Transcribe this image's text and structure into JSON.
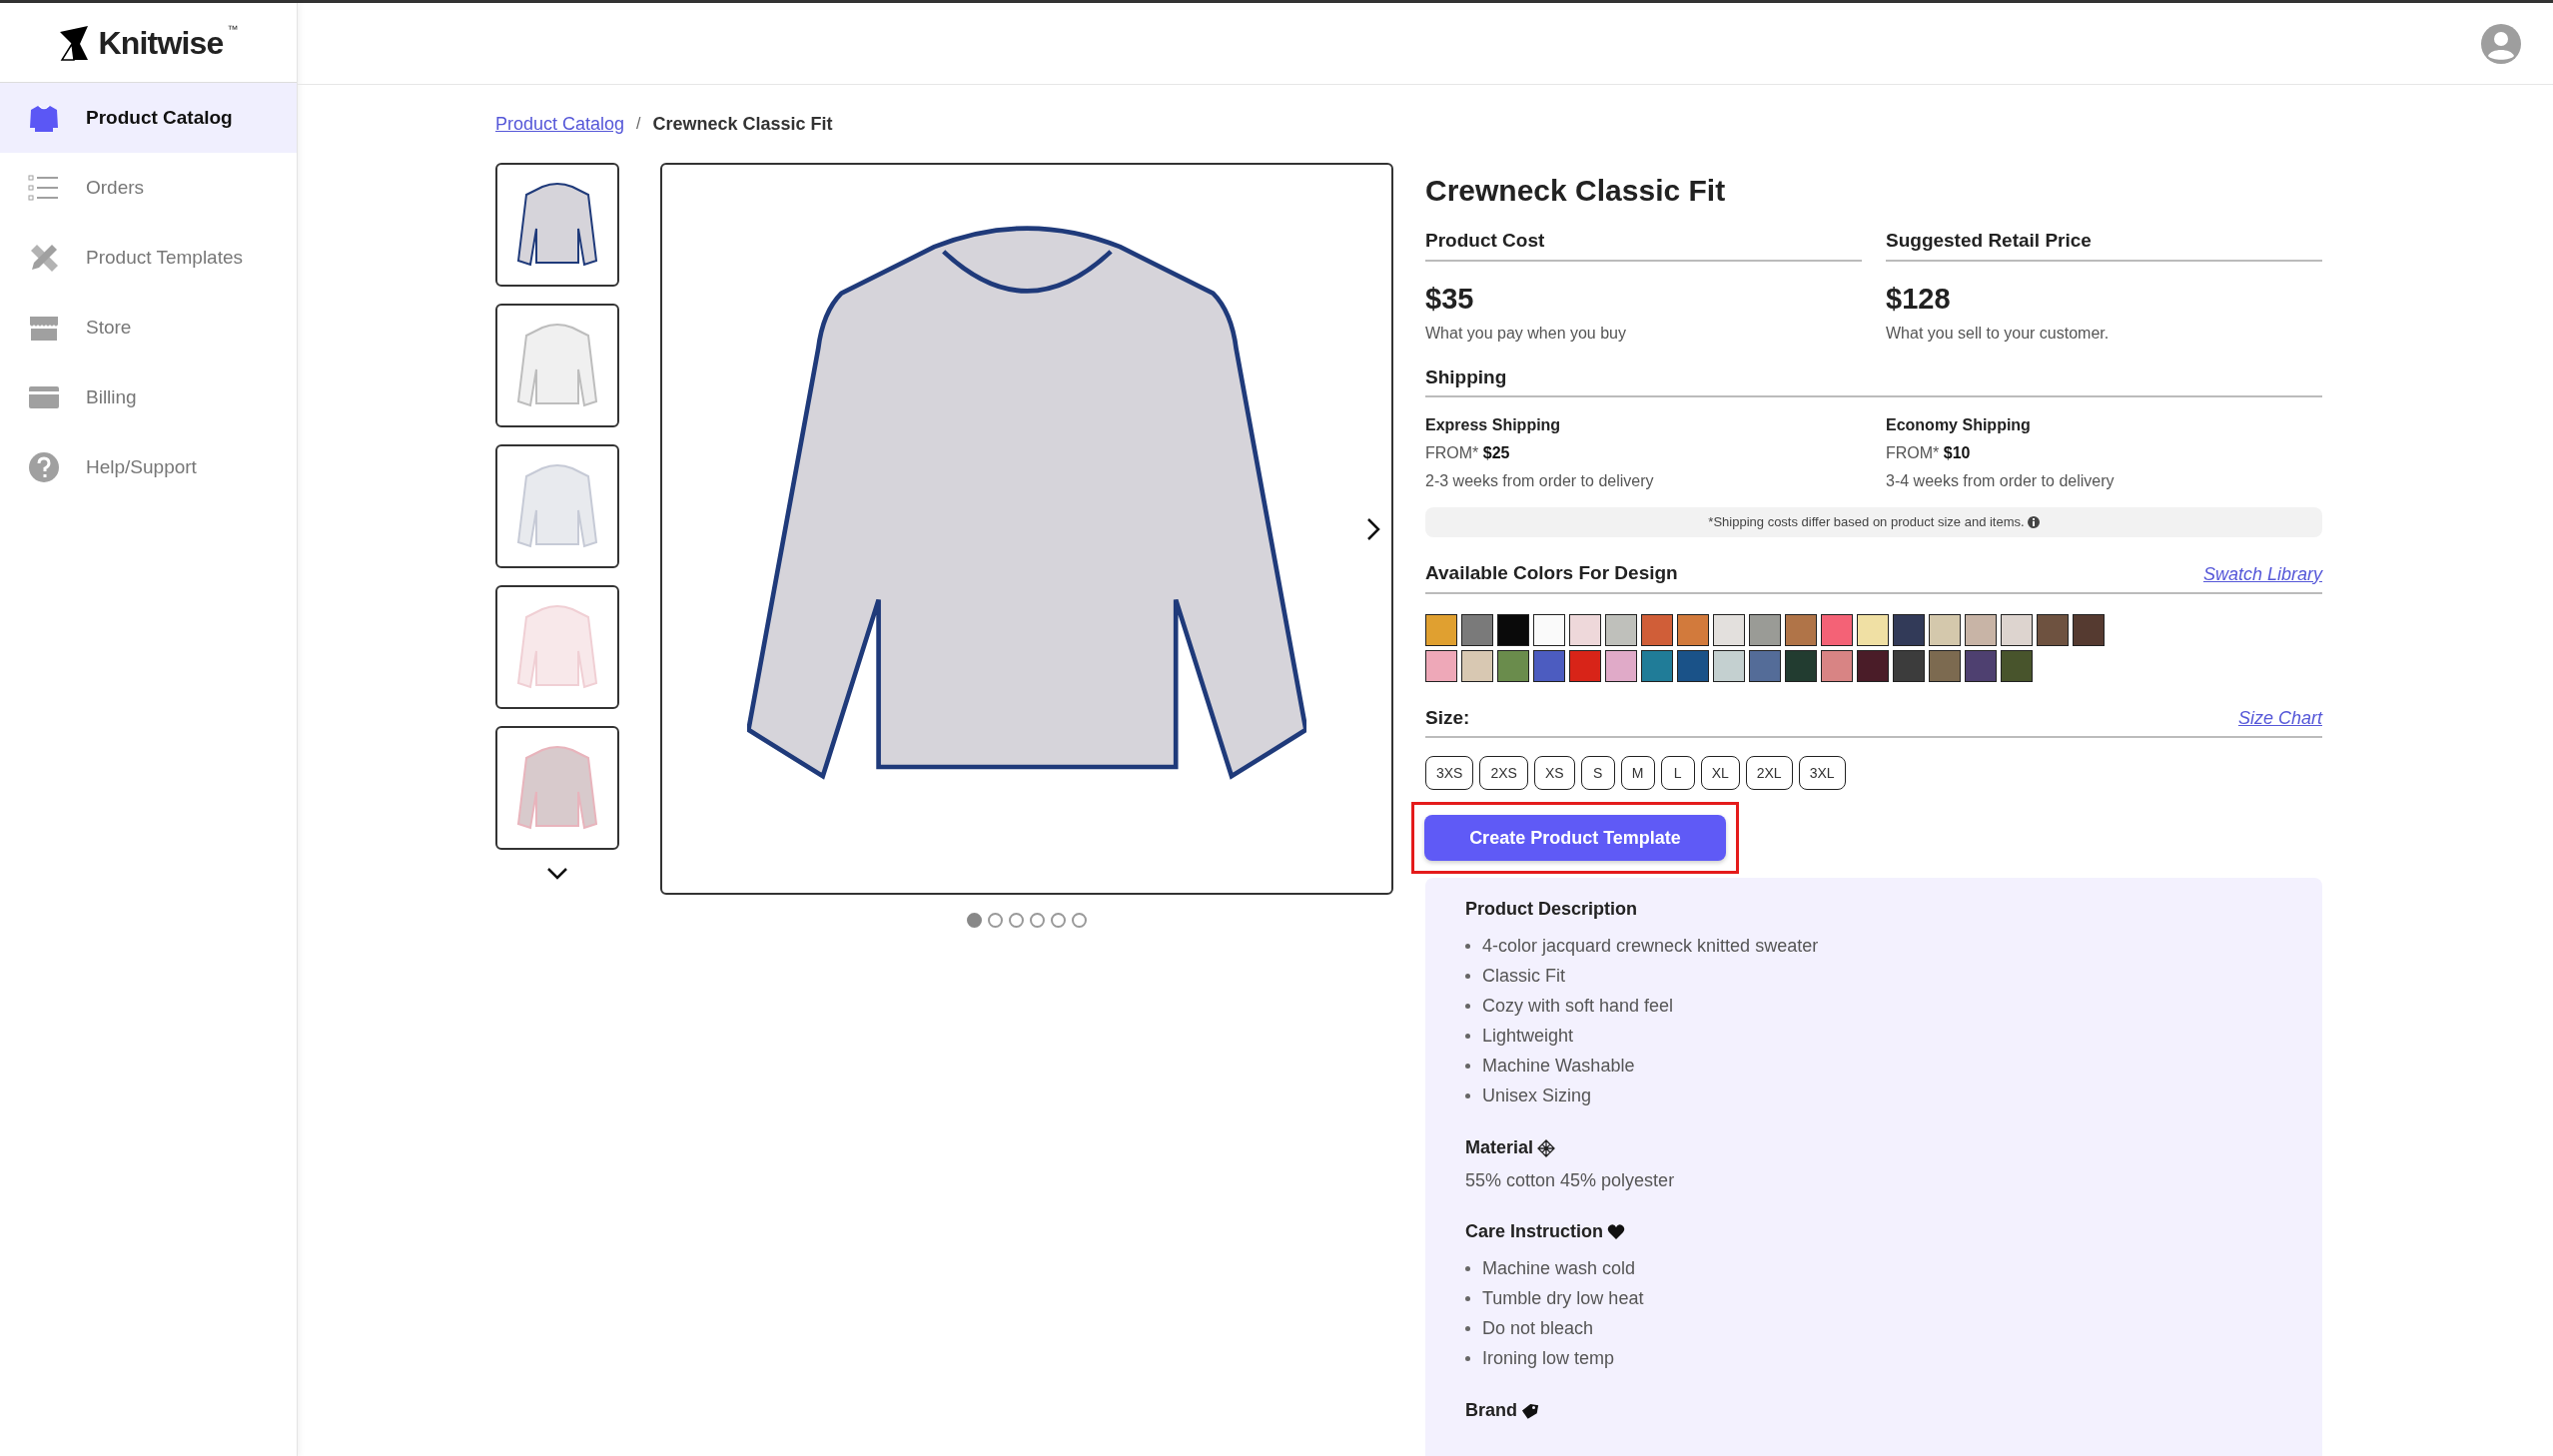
{
  "brand": {
    "name": "Knitwise",
    "trademark": "™"
  },
  "sidebar": {
    "items": [
      {
        "label": "Product Catalog",
        "kind": "sweater",
        "selected": true
      },
      {
        "label": "Orders",
        "kind": "list",
        "selected": false
      },
      {
        "label": "Product Templates",
        "kind": "tools",
        "selected": false
      },
      {
        "label": "Store",
        "kind": "store",
        "selected": false
      },
      {
        "label": "Billing",
        "kind": "card",
        "selected": false
      },
      {
        "label": "Help/Support",
        "kind": "help",
        "selected": false
      }
    ]
  },
  "breadcrumb_separator": "/",
  "breadcrumb": [
    {
      "label": "Product Catalog",
      "kind": "link"
    },
    {
      "label": "Crewneck Classic Fit",
      "kind": "current"
    }
  ],
  "gallery": {
    "dots": [
      {
        "selected": true
      },
      {
        "selected": false
      },
      {
        "selected": false
      },
      {
        "selected": false
      },
      {
        "selected": false
      },
      {
        "selected": false
      }
    ]
  },
  "product": {
    "title": "Crewneck Classic Fit",
    "pricing": [
      {
        "heading": "Product Cost",
        "price": "$35",
        "note": "What you pay when you buy"
      },
      {
        "heading": "Suggested Retail Price",
        "price": "$128",
        "note": "What you sell to your customer."
      }
    ],
    "shipping": {
      "heading": "Shipping",
      "options": [
        {
          "name": "Express Shipping",
          "from_label": "FROM*",
          "price": "$25",
          "time": "2-3 weeks from order to delivery"
        },
        {
          "name": "Economy Shipping",
          "from_label": "FROM*",
          "price": "$10",
          "time": "3-4 weeks from order to delivery"
        }
      ],
      "note": "*Shipping costs differ based on product size and items."
    },
    "colors": {
      "heading": "Available Colors For Design",
      "link": "Swatch Library",
      "swatches": [
        {
          "color": "#e0a030"
        },
        {
          "color": "#7a7a7a"
        },
        {
          "color": "#0a0a0a"
        },
        {
          "color": "#fafafa"
        },
        {
          "color": "#eed8da"
        },
        {
          "color": "#bfc0bb"
        },
        {
          "color": "#d05e38"
        },
        {
          "color": "#d27a3c"
        },
        {
          "color": "#e3e0dd"
        },
        {
          "color": "#9a9b96"
        },
        {
          "color": "#b07448"
        },
        {
          "color": "#f46276"
        },
        {
          "color": "#f0e0a4"
        },
        {
          "color": "#323a58"
        },
        {
          "color": "#d4c8ac"
        },
        {
          "color": "#c8b4a6"
        },
        {
          "color": "#ddd4cf"
        },
        {
          "color": "#6e5240"
        },
        {
          "color": "#553a30"
        },
        {
          "color": "#eea8b8"
        },
        {
          "color": "#d8c8b2"
        },
        {
          "color": "#6a8c4c"
        },
        {
          "color": "#4c5cc0"
        },
        {
          "color": "#d82418"
        },
        {
          "color": "#e0aac8"
        },
        {
          "color": "#207c98"
        },
        {
          "color": "#1a5288"
        },
        {
          "color": "#c4d0d0"
        },
        {
          "color": "#546c98"
        },
        {
          "color": "#223c30"
        },
        {
          "color": "#d88484"
        },
        {
          "color": "#4a1c28"
        },
        {
          "color": "#3c3c3c"
        },
        {
          "color": "#7c6a50"
        },
        {
          "color": "#4e4070"
        },
        {
          "color": "#48542c"
        }
      ]
    },
    "sizes": {
      "heading": "Size:",
      "link": "Size Chart",
      "options": [
        "3XS",
        "2XS",
        "XS",
        "S",
        "M",
        "L",
        "XL",
        "2XL",
        "3XL"
      ]
    },
    "create_button": {
      "label": "Create Product Template",
      "highlighted": true
    },
    "details": [
      {
        "kind": "list",
        "heading": "Product Description",
        "items": [
          "4-color jacquard crewneck knitted sweater",
          "Classic Fit",
          "Cozy with soft hand feel",
          "Lightweight",
          "Machine Washable",
          "Unisex Sizing"
        ]
      },
      {
        "kind": "text",
        "heading": "Material",
        "text": "55% cotton 45% polyester"
      },
      {
        "kind": "list",
        "heading": "Care Instruction",
        "items": [
          "Machine wash cold",
          "Tumble dry low heat",
          "Do not bleach",
          "Ironing low temp"
        ]
      },
      {
        "kind": "text",
        "heading": "Brand"
      }
    ]
  }
}
